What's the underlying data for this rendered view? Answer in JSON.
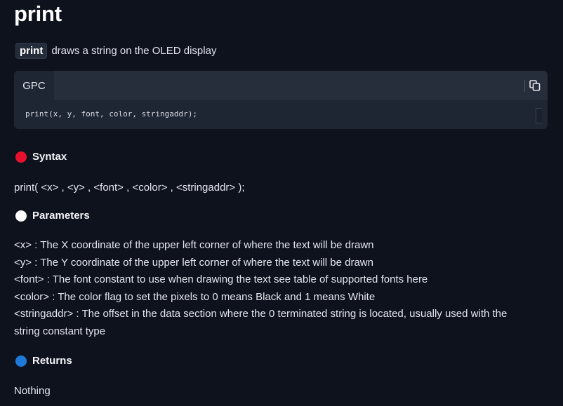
{
  "title": "print",
  "intro": {
    "keyword": "print",
    "description": "draws a string on the OLED display"
  },
  "code": {
    "tab_label": "GPC",
    "line": "print(x, y, font, color, stringaddr);",
    "copy_icon": "copy-icon"
  },
  "sections": {
    "syntax": {
      "heading": "Syntax",
      "dot_color": "#e8112d",
      "body": "print( <x> , <y> , <font> , <color> , <stringaddr> );"
    },
    "parameters": {
      "heading": "Parameters",
      "dot_color": "#ffffff",
      "rows": [
        "<x> : The X coordinate of the upper left corner of where the text will be drawn",
        "<y> : The Y coordinate of the upper left corner of where the text will be drawn",
        "<font> : The font constant to use when drawing the text see table of supported fonts here",
        "<color> : The color flag to set the pixels to 0 means Black and 1 means White",
        "<stringaddr> : The offset in the data section where the 0 terminated string is located, usually used with the",
        "string constant type"
      ]
    },
    "returns": {
      "heading": "Returns",
      "dot_color": "#1e7ad9",
      "body": "Nothing"
    }
  }
}
